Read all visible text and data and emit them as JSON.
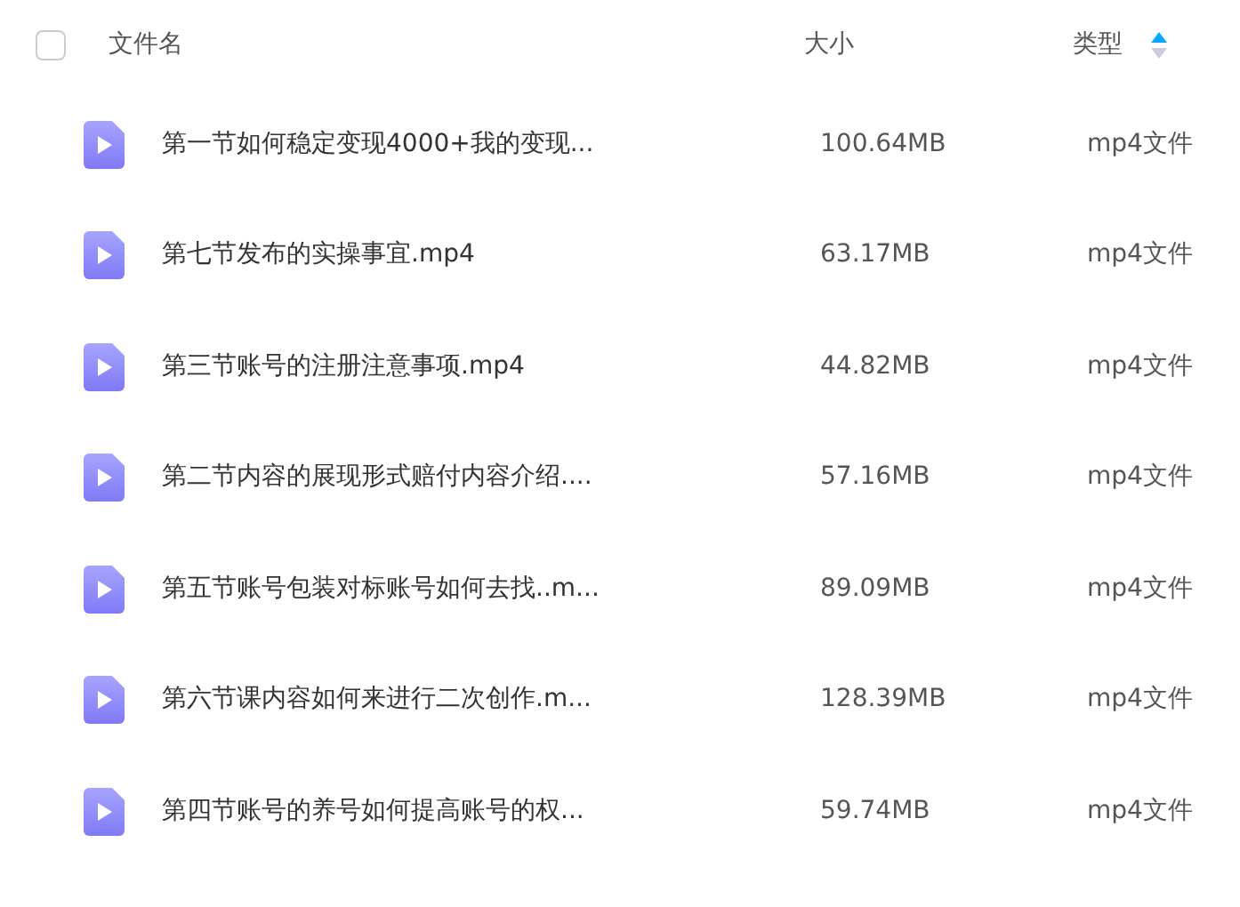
{
  "header": {
    "select_all": {
      "checked": false
    },
    "columns": [
      {
        "label": "文件名"
      },
      {
        "label": "大小"
      },
      {
        "label": "类型",
        "sort_ascending": true
      }
    ]
  },
  "files": [
    {
      "name": "第一节如何稳定变现4000+我的变现...",
      "size": "100.64MB",
      "type": "mp4文件"
    },
    {
      "name": "第七节发布的实操事宜.mp4",
      "size": "63.17MB",
      "type": "mp4文件"
    },
    {
      "name": "第三节账号的注册注意事项.mp4",
      "size": "44.82MB",
      "type": "mp4文件"
    },
    {
      "name": "第二节内容的展现形式赔付内容介绍....",
      "size": "57.16MB",
      "type": "mp4文件"
    },
    {
      "name": "第五节账号包装对标账号如何去找..m...",
      "size": "89.09MB",
      "type": "mp4文件"
    },
    {
      "name": "第六节课内容如何来进行二次创作.m...",
      "size": "128.39MB",
      "type": "mp4文件"
    },
    {
      "name": "第四节账号的养号如何提高账号的权...",
      "size": "59.74MB",
      "type": "mp4文件"
    }
  ]
}
